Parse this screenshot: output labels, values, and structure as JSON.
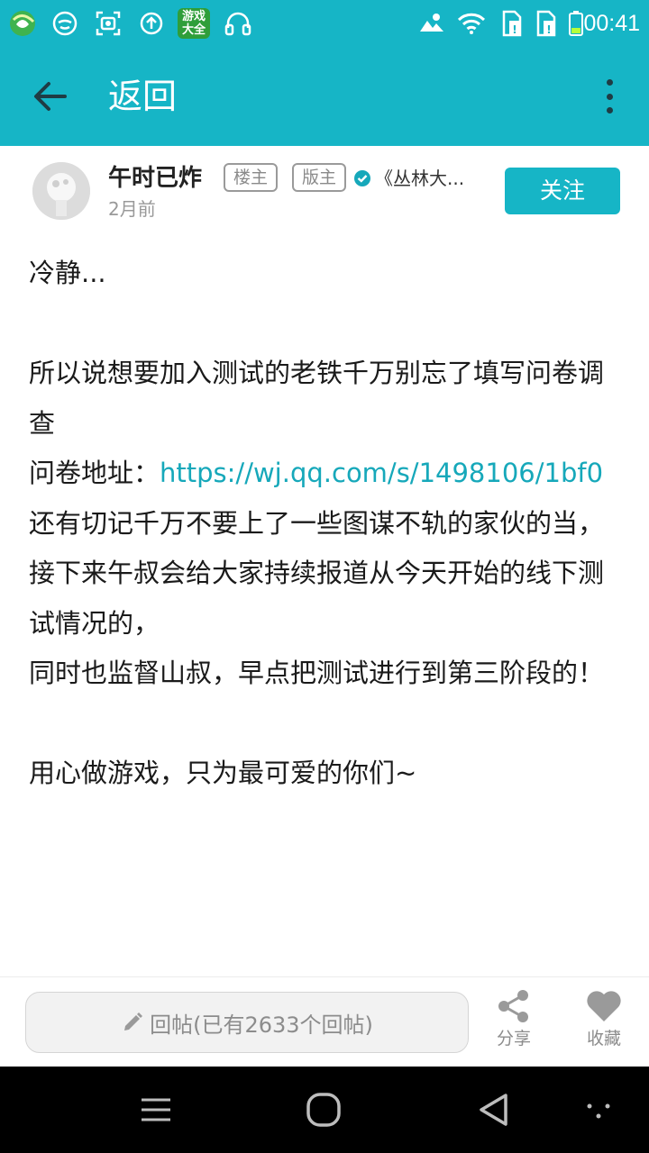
{
  "status_bar": {
    "time": "00:41",
    "left_icons": [
      "browser-icon",
      "face-mask-icon",
      "screenshot-icon",
      "upload-icon",
      "game-center-icon",
      "headphones-icon"
    ],
    "game_center_label_line1": "游戏",
    "game_center_label_line2": "大全",
    "right_icons": [
      "weather-icon",
      "wifi-icon",
      "sim1-icon",
      "sim2-icon",
      "battery-icon"
    ]
  },
  "app_bar": {
    "title": "返回",
    "back_icon": "arrow-left-icon",
    "more_icon": "more-vertical-icon"
  },
  "author": {
    "name": "午时已炸",
    "badge_owner": "楼主",
    "badge_moderator": "版主",
    "group": "《丛林大...",
    "time": "2月前",
    "follow_label": "关注"
  },
  "post": {
    "line1": "冷静...",
    "line2": "",
    "para1": "所以说想要加入测试的老铁千万别忘了填写问卷调查",
    "para2_prefix": "问卷地址：",
    "para2_link": "https://wj.qq.com/s/1498106/1bf0",
    "para3": "还有切记千万不要上了一些图谋不轨的家伙的当，",
    "para4": "接下来午叔会给大家持续报道从今天开始的线下测试情况的，",
    "para5": "同时也监督山叔，早点把测试进行到第三阶段的！",
    "para6": "",
    "para7": "用心做游戏，只为最可爱的你们~"
  },
  "reply_bar": {
    "placeholder": "回帖(已有2633个回帖)",
    "share_label": "分享",
    "favorite_label": "收藏"
  },
  "colors": {
    "accent": "#16b5c6",
    "link": "#16a8ba"
  }
}
